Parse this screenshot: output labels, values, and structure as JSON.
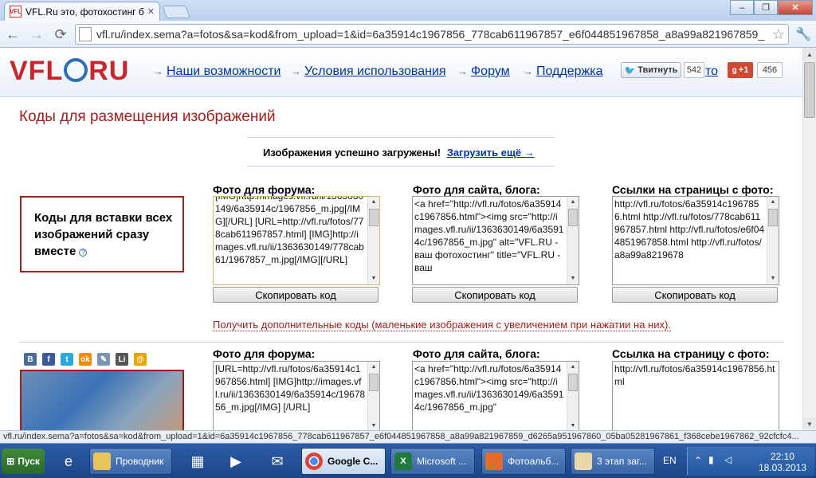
{
  "browser": {
    "tab_title": "VFL.Ru это, фотохостинг б",
    "favicon_text": "VFL",
    "url": "vfl.ru/index.sema?a=fotos&sa=kod&from_upload=1&id=6a35914c1967856_778cab611967857_e6f044851967858_a8a99a821967859_",
    "window_buttons": [
      "–",
      "❐",
      "✕"
    ]
  },
  "site": {
    "logo_left": "VFL",
    "logo_right": "RU",
    "menu": [
      "Наши возможности",
      "Условия использования",
      "Форум",
      "Поддержка",
      "то"
    ],
    "tweet_label": "Твитнуть",
    "tweet_count": "542",
    "gplus_label": "+1",
    "gplus_count": "456"
  },
  "main": {
    "heading": "Коды для размещения изображений",
    "success_text": "Изображения успешно загружены!",
    "upload_more": "Загрузить ещё →",
    "allcodes_box": "Коды для вставки всех изображений сразу вместе",
    "help_icon": "?",
    "group1": {
      "forum_label": "Фото для форума:",
      "site_label": "Фото для сайта, блога:",
      "links_label": "Ссылки на страницы с фото:",
      "forum_text": "[IMG]http://images.vfl.ru/ii/1363630149/6a35914c/1967856_m.jpg[/IMG][/URL] [URL=http://vfl.ru/fotos/778cab611967857.html] [IMG]http://images.vfl.ru/ii/1363630149/778cab61/1967857_m.jpg[/IMG][/URL]",
      "site_text": "<a href=\"http://vfl.ru/fotos/6a35914c1967856.html\"><img src=\"http://images.vfl.ru/ii/1363630149/6a35914c/1967856_m.jpg\" alt=\"VFL.RU - ваш фотохостинг\" title=\"VFL.RU - ваш",
      "links_text": "http://vfl.ru/fotos/6a35914c1967856.html http://vfl.ru/fotos/778cab611967857.html http://vfl.ru/fotos/e6f044851967858.html http://vfl.ru/fotos/a8a99a8219678",
      "copy": "Скопировать код"
    },
    "more_codes": "Получить дополнительные коды (маленькие изображения с увеличением при нажатии на них).",
    "group2": {
      "forum_label": "Фото для форума:",
      "site_label": "Фото для сайта, блога:",
      "link_label": "Ссылка на страницу с фото:",
      "forum_text": "[URL=http://vfl.ru/fotos/6a35914c1967856.html] [IMG]http://images.vfl.ru/ii/1363630149/6a35914c/1967856_m.jpg[/IMG] [/URL]",
      "site_text": "<a href=\"http://vfl.ru/fotos/6a35914c1967856.html\"><img src=\"http://images.vfl.ru/ii/1363630149/6a35914c/1967856_m.jpg\"",
      "link_text": "http://vfl.ru/fotos/6a35914c1967856.html"
    },
    "social": [
      {
        "icon": "vk-icon",
        "glyph": "В",
        "color": "#4b6d95"
      },
      {
        "icon": "facebook-icon",
        "glyph": "f",
        "color": "#3b5998"
      },
      {
        "icon": "twitter-icon",
        "glyph": "t",
        "color": "#2aa9e0"
      },
      {
        "icon": "odnoklassniki-icon",
        "glyph": "ok",
        "color": "#f28a0a"
      },
      {
        "icon": "livejournal-icon",
        "glyph": "✎",
        "color": "#7a96b0"
      },
      {
        "icon": "liveinternet-icon",
        "glyph": "Li",
        "color": "#555555"
      },
      {
        "icon": "mailru-icon",
        "glyph": "@",
        "color": "#e6a500"
      }
    ]
  },
  "status_url": "vfl.ru/index.sema?a=fotos&sa=kod&from_upload=1&id=6a35914c1967856_778cab611967857_e6f044851967858_a8a99a821967859_d6265a951967860_05ba05281967861_f368cebe1967862_92cfcfc4...",
  "taskbar": {
    "start": "Пуск",
    "items": [
      "Проводник",
      "Google C...",
      "Microsoft ...",
      "Фотоальб...",
      "3 этап заг..."
    ],
    "lang": "EN",
    "time": "22:10",
    "date": "18.03.2013"
  },
  "colors": {
    "accent_red": "#a31d1d",
    "link_blue": "#0033aa",
    "logo_blue": "#2d6fb8"
  }
}
